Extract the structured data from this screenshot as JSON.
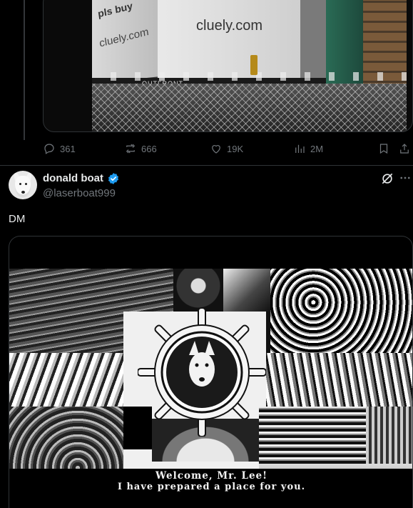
{
  "previous_tweet": {
    "media": {
      "billboard_texts": [
        "pls buy",
        "cluely.com",
        "cluely.com",
        "OUTFRONT"
      ]
    },
    "actions": {
      "replies": "361",
      "reposts": "666",
      "likes": "19K",
      "views": "2M"
    }
  },
  "tweet": {
    "display_name": "donald boat",
    "handle": "@laserboat999",
    "text": "DM",
    "media": {
      "caption_line1": "Welcome, Mr. Lee!",
      "caption_line2": "I have prepared a place for you."
    }
  },
  "colors": {
    "background": "#000000",
    "text_primary": "#e7e9ea",
    "text_secondary": "#71767b",
    "border": "#2f3336",
    "verified_blue": "#1d9bf0"
  },
  "icons": [
    "reply-icon",
    "repost-icon",
    "like-icon",
    "views-icon",
    "bookmark-icon",
    "share-icon",
    "verified-badge-icon",
    "grok-icon",
    "more-icon"
  ]
}
